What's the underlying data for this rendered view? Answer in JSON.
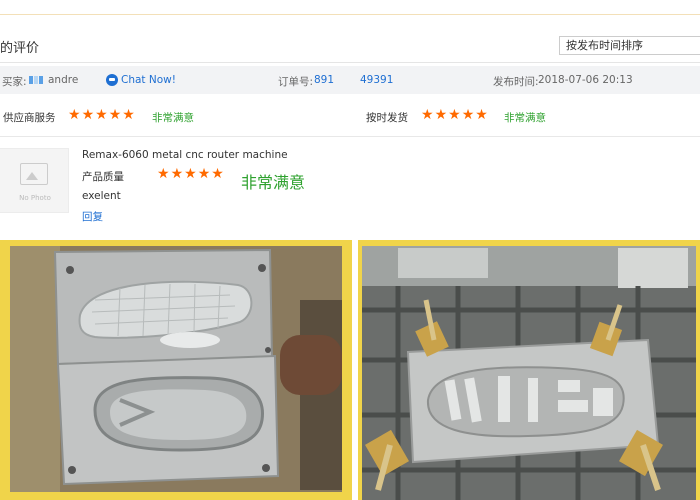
{
  "header": {
    "title": "的评价",
    "sort_selected": "按发布时间排序"
  },
  "info_bar": {
    "buyer_label": "买家:",
    "buyer_name": "andre",
    "chat_label": "Chat Now!",
    "order_label": "订单号:",
    "order_part1": "891",
    "order_part2": "49391",
    "publish_label": "发布时间:",
    "publish_time": "2018-07-06 20:13"
  },
  "ratings": {
    "supplier_service": {
      "label": "供应商服务",
      "stars": 5,
      "verdict": "非常满意"
    },
    "on_time_delivery": {
      "label": "按时发货",
      "stars": 5,
      "verdict": "非常满意"
    },
    "product_quality": {
      "label": "产品质量",
      "stars": 5,
      "verdict": "非常满意"
    }
  },
  "review": {
    "thumbnail_text": "No Photo",
    "product_name": "Remax-6060 metal cnc router machine",
    "comment": "exelent",
    "reply_label": "回复"
  },
  "colors": {
    "star": "#ff6a00",
    "verdict": "#2ea12e",
    "link": "#1f6fd2",
    "photo_border": "#f0d44a"
  },
  "photos": [
    {
      "subject": "two aluminium shoe sole molds held in hand"
    },
    {
      "subject": "shoe sole mold clamped on cnc router table"
    }
  ]
}
